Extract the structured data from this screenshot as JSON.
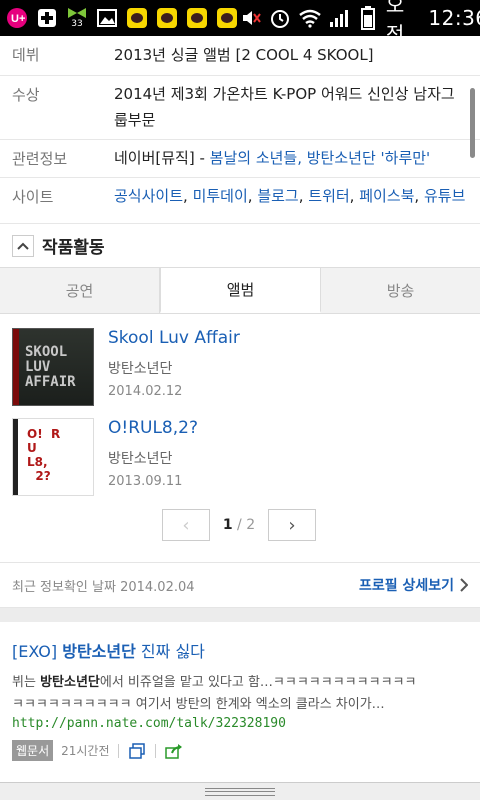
{
  "status_bar": {
    "notification_count": "33",
    "ampm": "오전",
    "time": "12:36"
  },
  "profile_rows": [
    {
      "label": "데뷔",
      "value": "2013년 싱글 앨범 [2 COOL 4 SKOOL]"
    },
    {
      "label": "수상",
      "value": "2014년 제3회 가온차트 K-POP 어워드 신인상 남자그룹부문"
    },
    {
      "label": "관련정보",
      "prefix": "네이버[뮤직] - ",
      "link": "봄날의 소년들, 방탄소년단 '하루만'"
    },
    {
      "label": "사이트",
      "links": [
        "공식사이트",
        "미투데이",
        "블로그",
        "트위터",
        "페이스북",
        "유튜브"
      ]
    }
  ],
  "section": {
    "title": "작품활동",
    "collapse_icon": "^"
  },
  "tabs": [
    {
      "label": "공연",
      "active": false
    },
    {
      "label": "앨범",
      "active": true
    },
    {
      "label": "방송",
      "active": false
    }
  ],
  "albums": [
    {
      "title": "Skool Luv Affair",
      "artist": "방탄소년단",
      "date": "2014.02.12",
      "cover_text": "SKOOL LUV AFFAIR"
    },
    {
      "title": "O!RUL8,2?",
      "artist": "방탄소년단",
      "date": "2013.09.11",
      "cover_text": "O!  R\nU\nL8,\n  2?"
    }
  ],
  "pager": {
    "current": "1",
    "total": "2",
    "separator": "/",
    "prev": "‹",
    "next": "›"
  },
  "info": {
    "updated": "최근 정보확인 날짜 2014.02.04",
    "profile_link": "프로필 상세보기"
  },
  "result": {
    "title_prefix": "[EXO] ",
    "title_bold": "방탄소년단",
    "title_suffix": " 진짜 싫다",
    "snippet_prefix": "뷔는 ",
    "snippet_bold": "방탄소년단",
    "snippet_line1_rest": "에서 비쥬얼을 맡고 있다고 함…ㅋㅋㅋㅋㅋㅋㅋㅋㅋㅋㅋㅋ",
    "snippet_line2": "ㅋㅋㅋㅋㅋㅋㅋㅋㅋㅋ 여기서 방탄의 한계와 엑소의 클라스 차이가…",
    "url": "http://pann.nate.com/talk/322328190",
    "badge": "웹문서",
    "time": "21시간전"
  },
  "colors": {
    "link": "#1a5fb4",
    "url": "#2a8a2a"
  }
}
